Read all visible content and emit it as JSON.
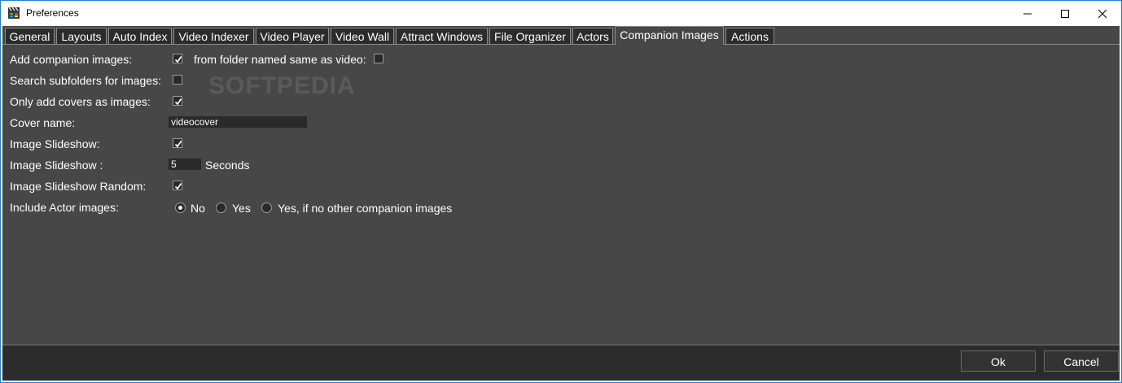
{
  "window": {
    "title": "Preferences"
  },
  "tabs": [
    {
      "label": "General"
    },
    {
      "label": "Layouts"
    },
    {
      "label": "Auto Index"
    },
    {
      "label": "Video Indexer"
    },
    {
      "label": "Video Player"
    },
    {
      "label": "Video Wall"
    },
    {
      "label": "Attract Windows"
    },
    {
      "label": "File Organizer"
    },
    {
      "label": "Actors"
    },
    {
      "label": "Companion Images",
      "active": true
    },
    {
      "label": "Actions"
    }
  ],
  "settings": {
    "add_companion": {
      "label": "Add companion images:",
      "checked": true
    },
    "from_folder": {
      "label": "from folder named same as video:",
      "checked": false
    },
    "search_subfolders": {
      "label": "Search subfolders for images:",
      "checked": false
    },
    "only_covers": {
      "label": "Only add covers as images:",
      "checked": true
    },
    "cover_name": {
      "label": "Cover name:",
      "value": "videocover"
    },
    "image_slideshow": {
      "label": "Image Slideshow:",
      "checked": true
    },
    "slideshow_seconds": {
      "label": "Image Slideshow :",
      "value": "5",
      "unit": "Seconds"
    },
    "slideshow_random": {
      "label": "Image Slideshow Random:",
      "checked": true
    },
    "include_actor": {
      "label": "Include Actor images:",
      "options": [
        "No",
        "Yes",
        "Yes, if no other companion images"
      ],
      "selected": "No"
    }
  },
  "watermark": "SOFTPEDIA",
  "buttons": {
    "ok": "Ok",
    "cancel": "Cancel"
  }
}
